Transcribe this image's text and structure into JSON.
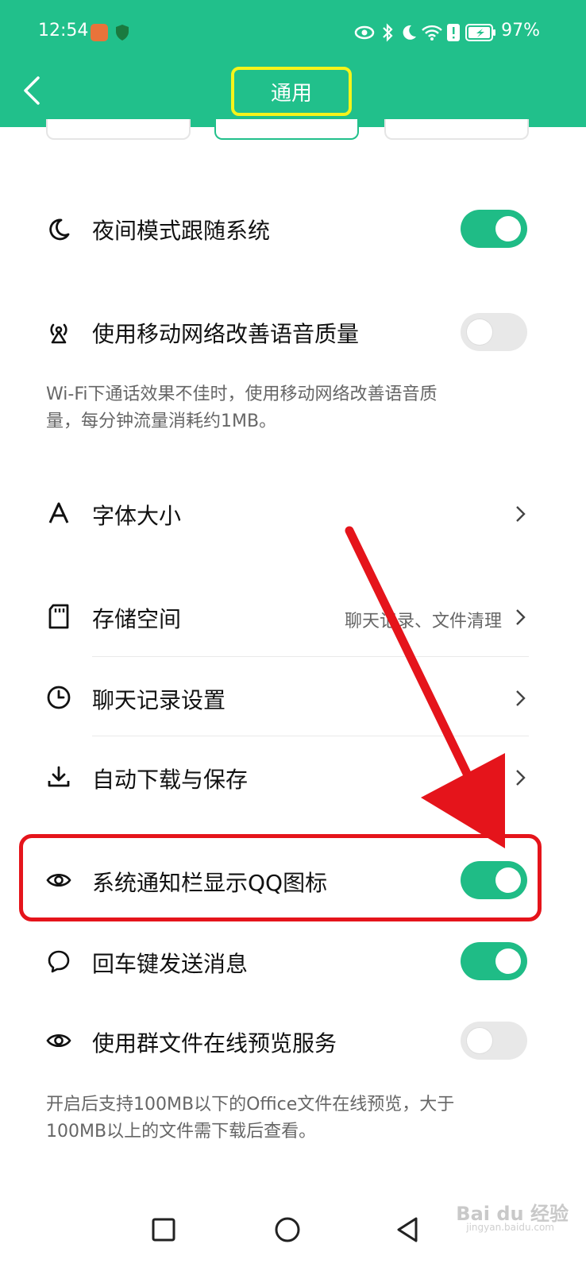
{
  "status_bar": {
    "time": "12:54",
    "battery": "97%"
  },
  "header": {
    "title": "通用"
  },
  "settings": {
    "night_mode": {
      "label": "夜间模式跟随系统",
      "enabled": true
    },
    "mobile_voice": {
      "label": "使用移动网络改善语音质量",
      "enabled": false,
      "desc_line1": "Wi-Fi下通话效果不佳时，使用移动网络改善语音质",
      "desc_line2": "量，每分钟流量消耗约1MB。"
    },
    "font_size": {
      "label": "字体大小"
    },
    "storage": {
      "label": "存储空间",
      "value": "聊天记录、文件清理"
    },
    "chat_history": {
      "label": "聊天记录设置"
    },
    "auto_download": {
      "label": "自动下载与保存"
    },
    "notif_icon": {
      "label": "系统通知栏显示QQ图标",
      "enabled": true
    },
    "enter_send": {
      "label": "回车键发送消息",
      "enabled": true
    },
    "group_file_preview": {
      "label": "使用群文件在线预览服务",
      "enabled": false,
      "desc_line1": "开启后支持100MB以下的Office文件在线预览，大于",
      "desc_line2": "100MB以上的文件需下载后查看。"
    }
  },
  "watermark": {
    "brand": "Bai du 经验",
    "url": "jingyan.baidu.com"
  },
  "colors": {
    "accent": "#21c08b",
    "toggle_on": "#1fbc86",
    "highlight": "#e5141b",
    "title_box": "#f6f41a"
  }
}
